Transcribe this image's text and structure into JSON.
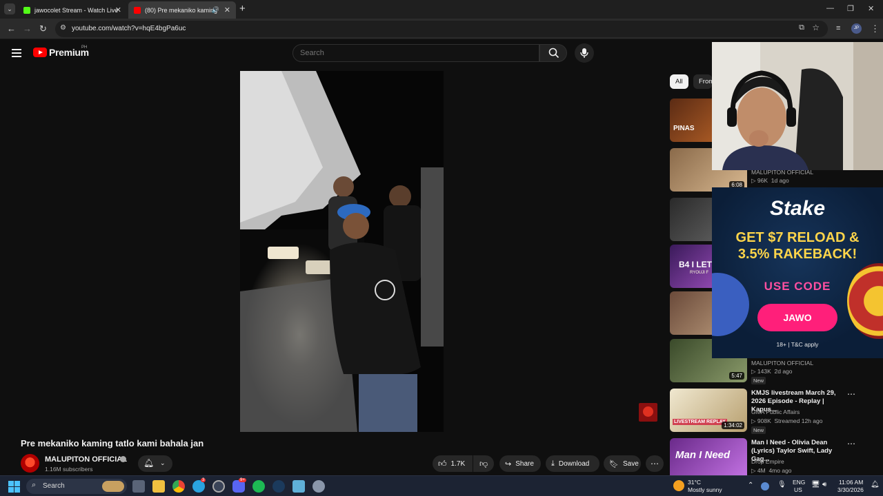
{
  "browser": {
    "tabs": [
      {
        "title": "jawocolet Stream - Watch Live",
        "favicon_color": "#53fc18"
      },
      {
        "title": "(80) Pre mekaniko kaming",
        "favicon_color": "#ff0000"
      }
    ],
    "new_tab": "+",
    "url": "youtube.com/watch?v=hqE4bgPa6uc",
    "profile_initials": "JP",
    "window_controls": [
      "—",
      "❐",
      "✕"
    ]
  },
  "header": {
    "logo_text": "Premium",
    "region": "PH",
    "search_placeholder": "Search"
  },
  "video": {
    "title": "Pre mekaniko kaming tatlo kami bahala jan",
    "channel": "MALUPITON OFFICIAL",
    "subscribers": "1.16M subscribers",
    "likes": "1.7K",
    "share": "Share",
    "download": "Download",
    "save": "Save"
  },
  "chips": [
    "All",
    "From"
  ],
  "related": [
    {
      "thumb_text": "PINAS",
      "colors": [
        "#5b2b14",
        "#c46a2a"
      ]
    },
    {
      "duration": "6:08",
      "channel": "MALUPITON OFFICIAL",
      "meta": "96K · 1d ago",
      "views": "96K",
      "age": "1d ago",
      "colors": [
        "#8a6a4a",
        "#d8b890"
      ]
    },
    {
      "colors": [
        "#2a2a2a",
        "#6a6a6a"
      ]
    },
    {
      "thumb_text": "B4 I LET",
      "sub_text": "RYOUJI F",
      "colors": [
        "#3a1a5a",
        "#b05ad0"
      ]
    },
    {
      "colors": [
        "#6a4a3a",
        "#c0a080"
      ]
    },
    {
      "duration": "5:47",
      "channel": "MALUPITON OFFICIAL",
      "views": "143K",
      "age": "2d ago",
      "badge": "New",
      "colors": [
        "#3a4a2a",
        "#8a9a6a"
      ]
    },
    {
      "duration": "1:34:02",
      "title": "KMJS livestream March 29, 2026 Episode - Replay | Kapus...",
      "channel": "GMA Public Affairs",
      "views": "908K",
      "age": "Streamed 12h ago",
      "badge": "New",
      "thumb_text": "LIVESTREAM REPLAY",
      "colors": [
        "#f0e8d0",
        "#b8a070"
      ]
    },
    {
      "title": "Man I Need - Olivia Dean (Lyrics) Taylor Swift, Lady Gag...",
      "channel": "Drop Empire",
      "views": "4M",
      "age": "4mo ago",
      "thumb_text": "Man I Need",
      "colors": [
        "#6a2a8a",
        "#c070e0"
      ]
    }
  ],
  "ad": {
    "brand": "Stake",
    "headline_1": "GET $7 RELOAD &",
    "headline_2": "3.5% RAKEBACK!",
    "use_code": "USE CODE",
    "code": "JAWO",
    "disclaimer": "18+ | T&C apply"
  },
  "taskbar": {
    "search": "Search",
    "weather_temp": "31°C",
    "weather_desc": "Mostly sunny",
    "lang_1": "ENG",
    "lang_2": "US",
    "time": "11:06 AM",
    "date": "3/30/2026",
    "telegram_badge": "3",
    "discord_badge": "9+"
  }
}
